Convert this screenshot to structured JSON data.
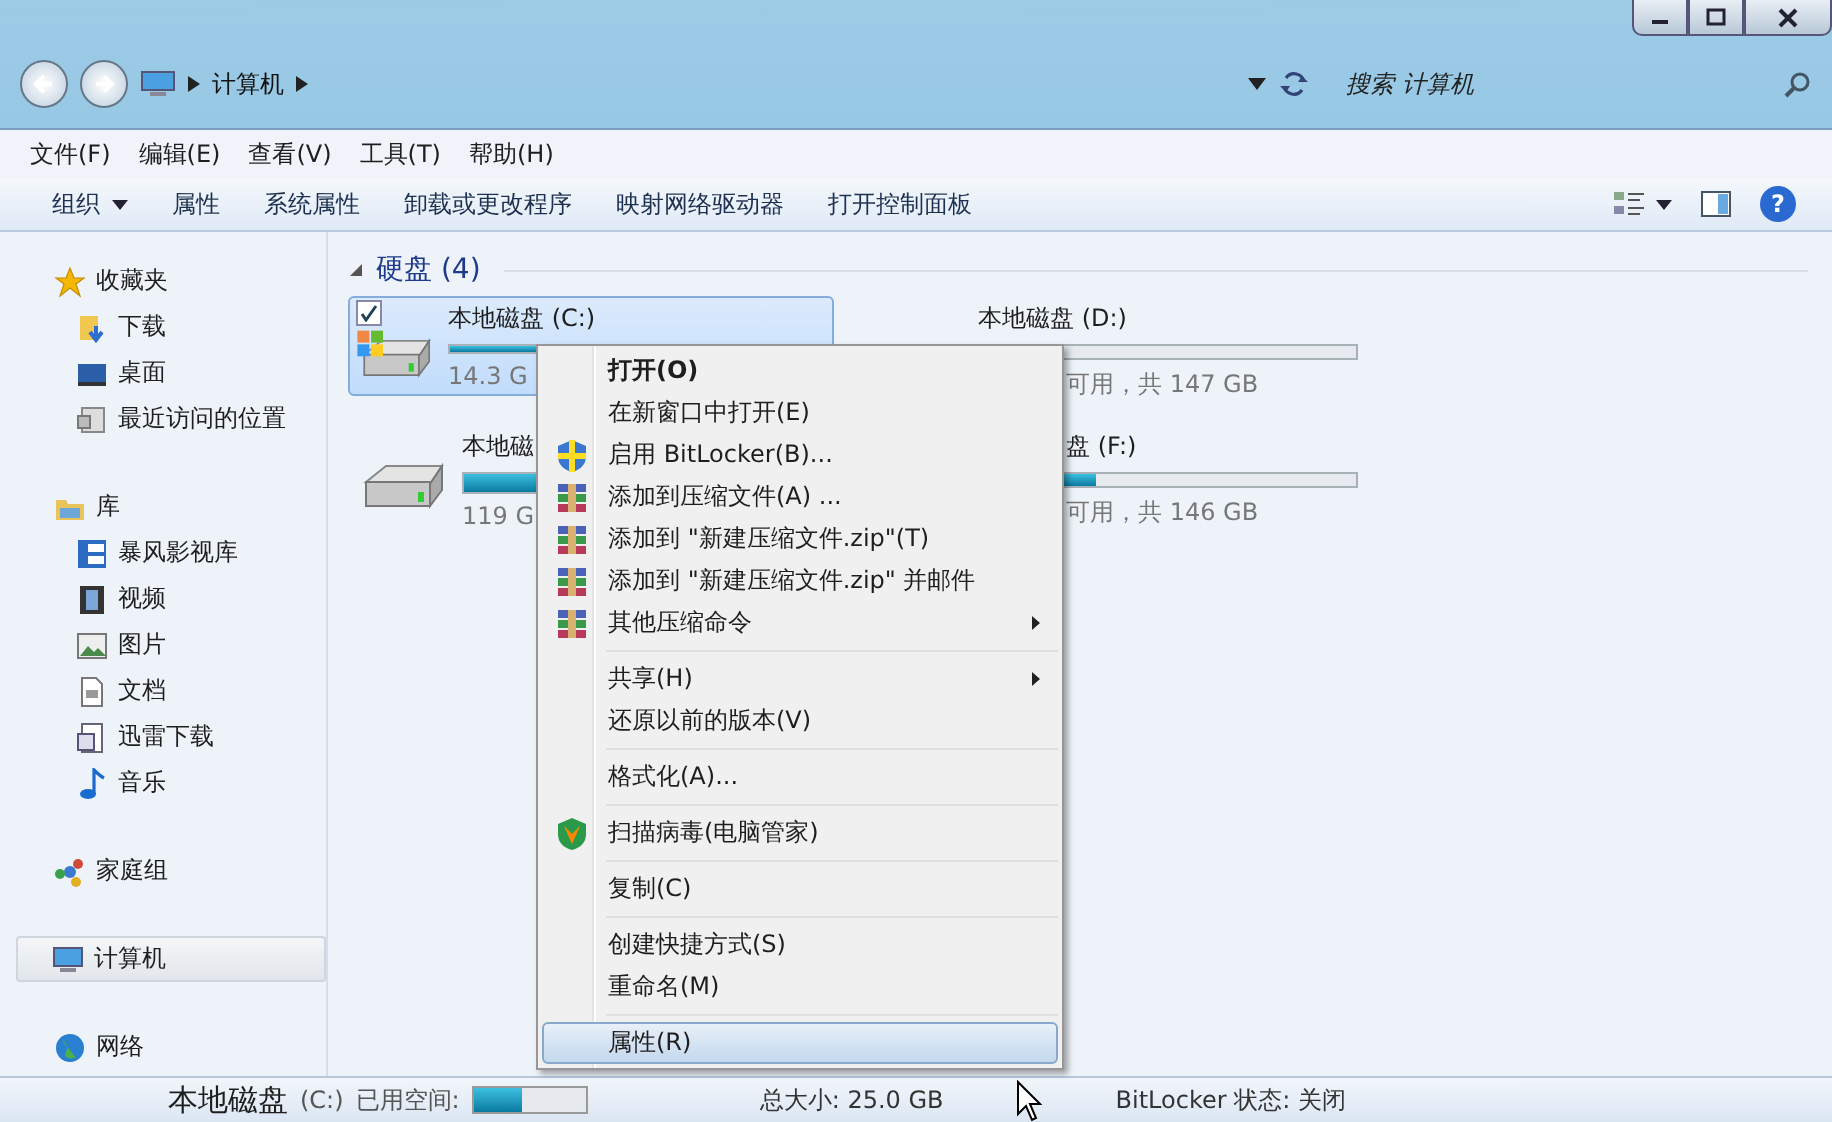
{
  "address_bar": {
    "path": [
      "计算机"
    ],
    "search": {
      "placeholder": "搜索 计算机"
    }
  },
  "menu_bar": [
    "文件(F)",
    "编辑(E)",
    "查看(V)",
    "工具(T)",
    "帮助(H)"
  ],
  "toolbar": [
    {
      "label": "组织",
      "dropdown": true
    },
    {
      "label": "属性",
      "dropdown": false
    },
    {
      "label": "系统属性",
      "dropdown": false
    },
    {
      "label": "卸载或更改程序",
      "dropdown": false
    },
    {
      "label": "映射网络驱动器",
      "dropdown": false
    },
    {
      "label": "打开控制面板",
      "dropdown": false
    }
  ],
  "sidebar": {
    "items": [
      {
        "label": "收藏夹",
        "selected": false,
        "children": [
          {
            "label": "下载",
            "selected": false
          },
          {
            "label": "桌面",
            "selected": false
          },
          {
            "label": "最近访问的位置",
            "selected": false
          }
        ]
      },
      {
        "label": "库",
        "selected": false,
        "children": [
          {
            "label": "暴风影视库",
            "selected": false
          },
          {
            "label": "视频",
            "selected": false
          },
          {
            "label": "图片",
            "selected": false
          },
          {
            "label": "文档",
            "selected": false
          },
          {
            "label": "迅雷下载",
            "selected": false
          },
          {
            "label": "音乐",
            "selected": false
          }
        ]
      },
      {
        "label": "家庭组",
        "selected": false
      },
      {
        "label": "计算机",
        "selected": true
      },
      {
        "label": "网络",
        "selected": false
      }
    ]
  },
  "help_button": "?",
  "group": {
    "title": "硬盘 (4)",
    "expanded": true,
    "drives": [
      {
        "name": "本地磁盘 (C:)",
        "info": "14.3 G",
        "level": 0.43,
        "selected": true,
        "checked": true,
        "kind": "system"
      },
      {
        "name": "本地磁盘 (D:)",
        "info": "可用，共 147 GB",
        "level": 0.15,
        "selected": false,
        "checked": false,
        "kind": "hidden"
      },
      {
        "name": "本地磁",
        "info": "119 G",
        "level": 0.5,
        "selected": false,
        "checked": false,
        "kind": "plain"
      },
      {
        "name": "盘 (F:)",
        "info": "可用，共 146 GB",
        "level": 0.31,
        "selected": false,
        "checked": false,
        "kind": "hidden"
      }
    ]
  },
  "context_menu": [
    {
      "kind": "item",
      "label": "打开(O)",
      "bold": true,
      "submenu": false,
      "selected": false
    },
    {
      "kind": "item",
      "label": "在新窗口中打开(E)",
      "bold": false,
      "submenu": false,
      "selected": false
    },
    {
      "kind": "shield",
      "label": "启用 BitLocker(B)...",
      "bold": false,
      "submenu": false,
      "selected": false
    },
    {
      "kind": "archive",
      "label": "添加到压缩文件(A) ...",
      "bold": false,
      "submenu": false,
      "selected": false
    },
    {
      "kind": "archive",
      "label": "添加到 \"新建压缩文件.zip\"(T)",
      "bold": false,
      "submenu": false,
      "selected": false
    },
    {
      "kind": "archive",
      "label": "添加到 \"新建压缩文件.zip\" 并邮件",
      "bold": false,
      "submenu": false,
      "selected": false
    },
    {
      "kind": "archive",
      "label": "其他压缩命令",
      "bold": false,
      "submenu": true,
      "selected": false
    },
    {
      "kind": "separator"
    },
    {
      "kind": "item",
      "label": "共享(H)",
      "bold": false,
      "submenu": true,
      "selected": false
    },
    {
      "kind": "item",
      "label": "还原以前的版本(V)",
      "bold": false,
      "submenu": false,
      "selected": false
    },
    {
      "kind": "separator"
    },
    {
      "kind": "item",
      "label": "格式化(A)...",
      "bold": false,
      "submenu": false,
      "selected": false
    },
    {
      "kind": "separator"
    },
    {
      "kind": "antivirus",
      "label": "扫描病毒(电脑管家)",
      "bold": false,
      "submenu": false,
      "selected": false
    },
    {
      "kind": "separator"
    },
    {
      "kind": "item",
      "label": "复制(C)",
      "bold": false,
      "submenu": false,
      "selected": false
    },
    {
      "kind": "separator"
    },
    {
      "kind": "item",
      "label": "创建快捷方式(S)",
      "bold": false,
      "submenu": false,
      "selected": false
    },
    {
      "kind": "item",
      "label": "重命名(M)",
      "bold": false,
      "submenu": false,
      "selected": false
    },
    {
      "kind": "separator"
    },
    {
      "kind": "item",
      "label": "属性(R)",
      "bold": false,
      "submenu": false,
      "selected": true
    }
  ],
  "details": {
    "name": "本地磁盘",
    "drive_letter": "(C:)",
    "used_label": "已用空间:",
    "level": 0.43,
    "total": "总大小: 25.0 GB",
    "bitlocker": "BitLocker 状态: 关闭"
  }
}
